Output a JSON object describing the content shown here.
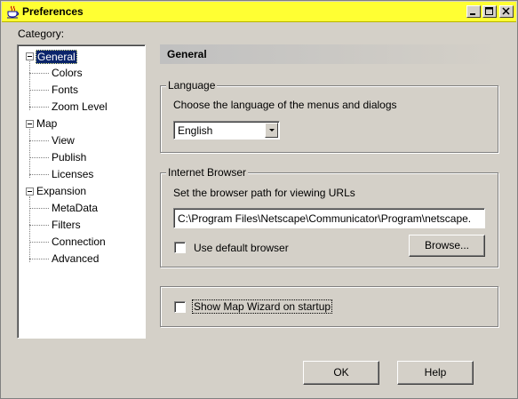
{
  "window": {
    "title": "Preferences",
    "icon": "java-cup-icon",
    "title_bar_color": "#ffff33",
    "controls": [
      "minimize",
      "maximize",
      "close"
    ]
  },
  "category_label": "Category:",
  "tree": {
    "nodes": [
      {
        "label": "General",
        "level": 0,
        "expanded": true,
        "selected": true
      },
      {
        "label": "Colors",
        "level": 1
      },
      {
        "label": "Fonts",
        "level": 1
      },
      {
        "label": "Zoom Level",
        "level": 1
      },
      {
        "label": "Map",
        "level": 0,
        "expanded": true
      },
      {
        "label": "View",
        "level": 1
      },
      {
        "label": "Publish",
        "level": 1
      },
      {
        "label": "Licenses",
        "level": 1
      },
      {
        "label": "Expansion",
        "level": 0,
        "expanded": true
      },
      {
        "label": "MetaData",
        "level": 1
      },
      {
        "label": "Filters",
        "level": 1
      },
      {
        "label": "Connection",
        "level": 1
      },
      {
        "label": "Advanced",
        "level": 1
      }
    ]
  },
  "panel": {
    "title": "General",
    "language": {
      "legend": "Language",
      "description": "Choose the language of the menus and dialogs",
      "selected": "English"
    },
    "browser": {
      "legend": "Internet Browser",
      "description": "Set the browser path for viewing URLs",
      "path": "C:\\Program Files\\Netscape\\Communicator\\Program\\netscape.",
      "use_default_label": "Use default browser",
      "use_default_checked": false,
      "browse_label": "Browse..."
    },
    "wizard": {
      "label": "Show Map Wizard on startup",
      "checked": false
    }
  },
  "buttons": {
    "ok": "OK",
    "help": "Help"
  },
  "colors": {
    "selection": "#0a246a",
    "dialog_bg": "#d4d0c8"
  }
}
